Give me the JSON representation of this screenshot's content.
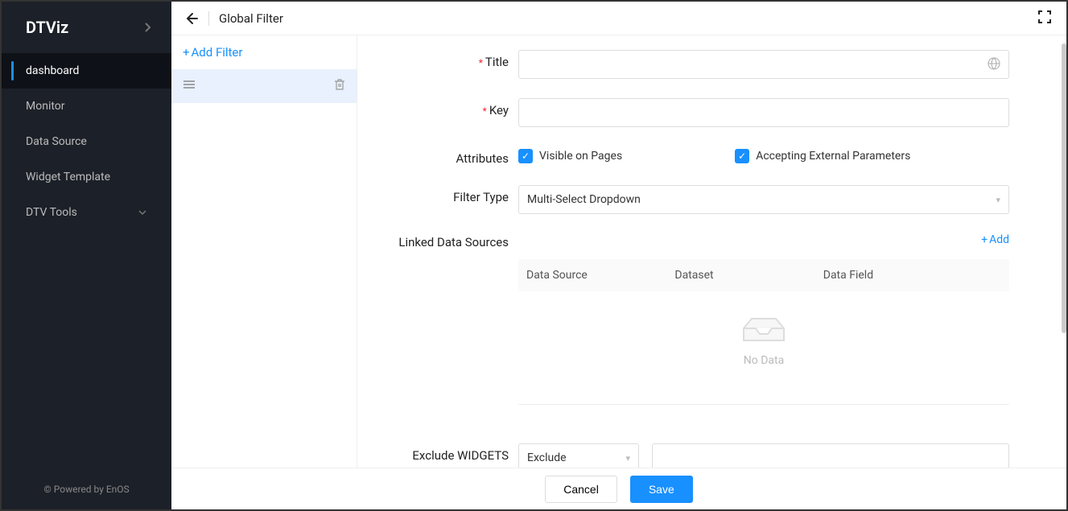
{
  "sidebar": {
    "title": "DTViz",
    "items": [
      {
        "label": "dashboard",
        "active": true
      },
      {
        "label": "Monitor"
      },
      {
        "label": "Data Source"
      },
      {
        "label": "Widget Template"
      },
      {
        "label": "DTV Tools",
        "expandable": true
      }
    ],
    "footer": "© Powered by EnOS"
  },
  "header": {
    "title": "Global Filter"
  },
  "filterList": {
    "addLabel": "Add Filter"
  },
  "form": {
    "titleLabel": "Title",
    "keyLabel": "Key",
    "attributesLabel": "Attributes",
    "visibleLabel": "Visible on Pages",
    "acceptExtLabel": "Accepting External Parameters",
    "filterTypeLabel": "Filter Type",
    "filterTypeValue": "Multi-Select Dropdown",
    "linkedDsLabel": "Linked Data Sources",
    "addLabel": "Add",
    "columns": {
      "c1": "Data Source",
      "c2": "Dataset",
      "c3": "Data Field"
    },
    "noData": "No Data",
    "excludeLabel": "Exclude WIDGETS",
    "excludeValue": "Exclude"
  },
  "footer": {
    "cancel": "Cancel",
    "save": "Save"
  }
}
